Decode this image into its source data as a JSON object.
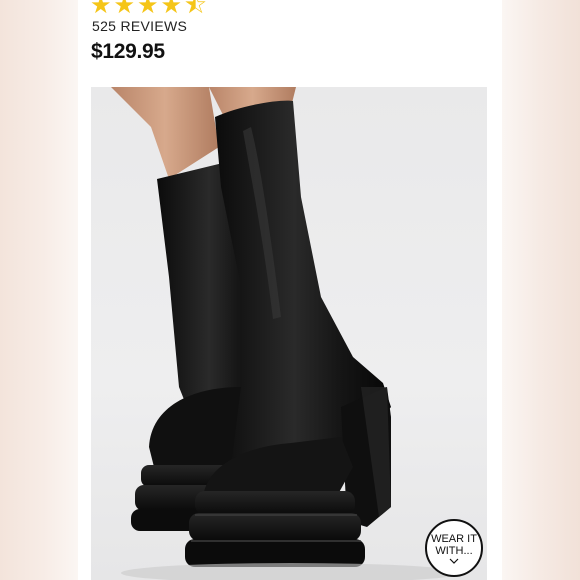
{
  "product": {
    "rating_stars": 4.5,
    "reviews_label": "525 REVIEWS",
    "price": "$129.95"
  },
  "image": {
    "subject": "black-knee-high-platform-boots-icon"
  },
  "wear_it_with": {
    "line1": "WEAR IT",
    "line2": "WITH..."
  },
  "colors": {
    "star": "#f5c518",
    "text": "#111111",
    "backdrop": "#e9e9ea",
    "boot": "#141414"
  }
}
